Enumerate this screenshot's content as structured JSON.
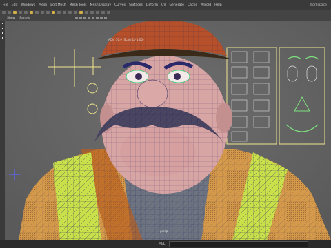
{
  "menu": {
    "items": [
      "File",
      "Edit",
      "Windows",
      "Mesh",
      "Edit Mesh",
      "Mesh Tools",
      "Mesh Display",
      "Curves",
      "Surfaces",
      "Deform",
      "UV",
      "Generate",
      "Cache",
      "Arnold",
      "Help"
    ],
    "right_label": "Workspace"
  },
  "panel": {
    "items": [
      "Show",
      "Panels"
    ]
  },
  "viewport": {
    "camera_label": "persp",
    "hud_label": "AOV: 16:9 (Scale 1 / 1.00)"
  },
  "status": {
    "field_label": "MEL"
  },
  "colors": {
    "wire": "#1a1a55",
    "vest": "#d59a4a",
    "reflective": "#c9e04a",
    "hat": "#b5502a",
    "skin": "#d8a5a5",
    "shirt": "#6e7480",
    "ui_bg": "#3b3b3b"
  }
}
